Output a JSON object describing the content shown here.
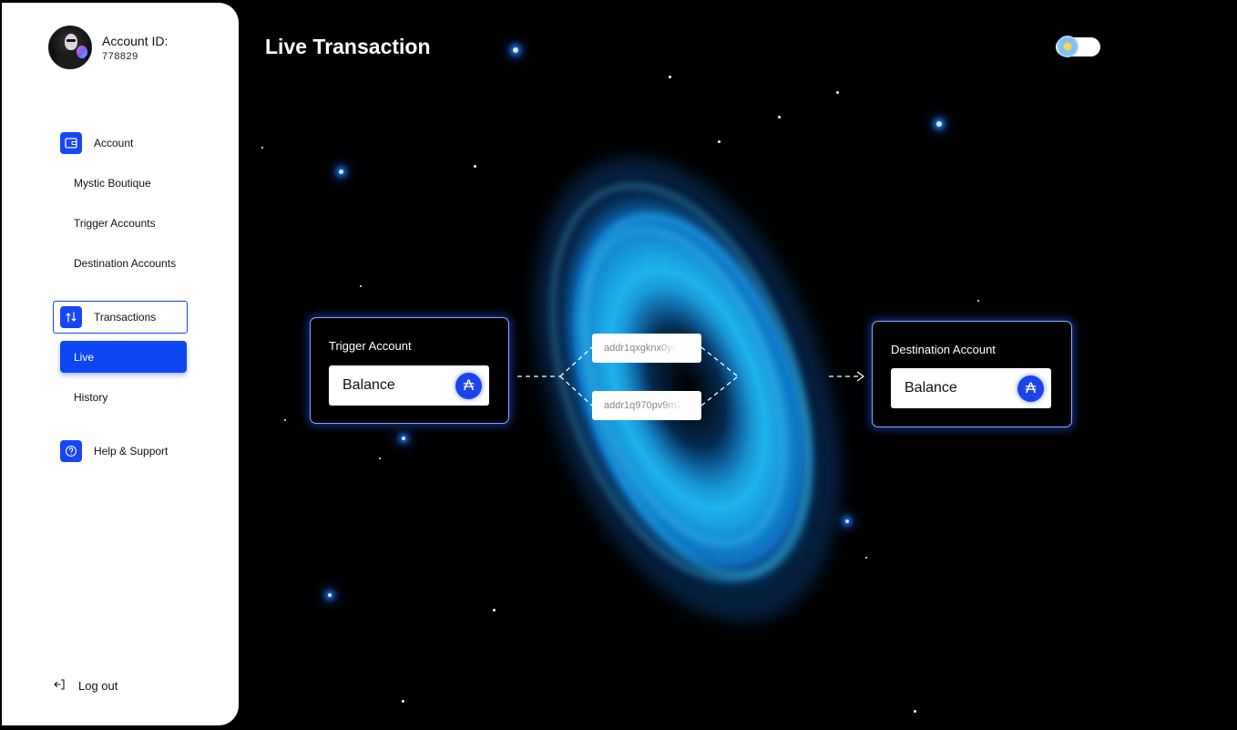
{
  "sidebar": {
    "profile": {
      "label": "Account ID:",
      "id": "778829"
    },
    "account_label": "Account",
    "account_items": [
      "Mystic Boutique",
      "Trigger Accounts",
      "Destination Accounts"
    ],
    "transactions_label": "Transactions",
    "transaction_items": [
      "Live",
      "History"
    ],
    "help_label": "Help & Support",
    "logout_label": "Log out",
    "accent_color": "#1646f5"
  },
  "header": {
    "title": "Live Transaction"
  },
  "theme_toggle": {
    "icon": "sun-cloud-icon",
    "state": "day"
  },
  "trigger_card": {
    "title": "Trigger Account",
    "balance_label": "Balance",
    "currency_icon": "ada-icon"
  },
  "destination_card": {
    "title": "Destination Account",
    "balance_label": "Balance",
    "currency_icon": "ada-icon"
  },
  "addresses": [
    "addr1qxgknx0ys",
    "addr1q970pv9m2"
  ],
  "icons": {
    "account": "wallet-icon",
    "transactions": "transfer-arrows-icon",
    "help": "question-circle-icon",
    "logout": "logout-icon",
    "ada": "cardano-ada-glyph"
  }
}
